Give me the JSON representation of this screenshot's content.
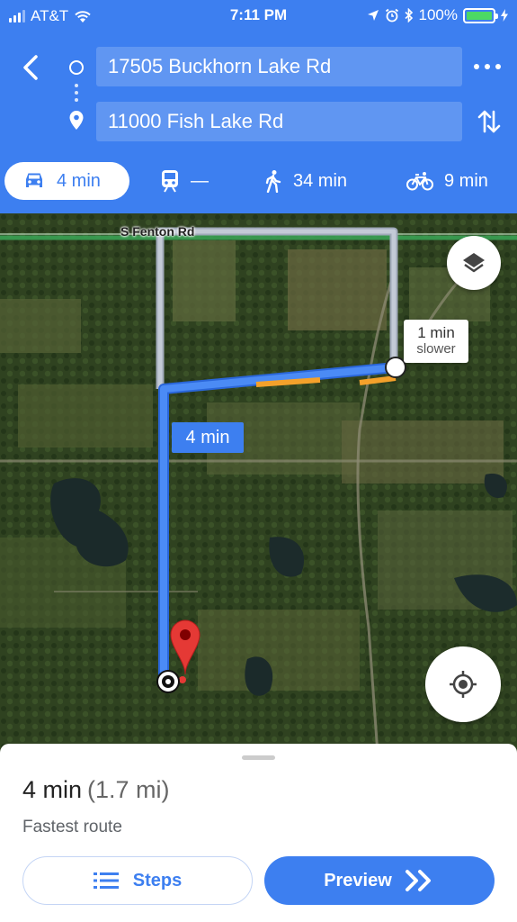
{
  "status_bar": {
    "carrier": "AT&T",
    "time": "7:11 PM",
    "battery": "100%"
  },
  "directions": {
    "origin": "17505 Buckhorn Lake Rd",
    "destination": "11000 Fish Lake Rd"
  },
  "modes": [
    {
      "name": "drive",
      "icon": "car-icon",
      "label": "4 min",
      "active": true
    },
    {
      "name": "transit",
      "icon": "train-icon",
      "label": "—",
      "active": false
    },
    {
      "name": "walk",
      "icon": "walking-icon",
      "label": "34 min",
      "active": false
    },
    {
      "name": "bike",
      "icon": "bicycle-icon",
      "label": "9 min",
      "active": false
    }
  ],
  "map": {
    "road_label": "S Fenton Rd",
    "route_time_label": "4 min",
    "alt_route_time": "1 min",
    "alt_route_note": "slower"
  },
  "summary": {
    "duration": "4 min",
    "distance": "(1.7 mi)",
    "description": "Fastest route"
  },
  "buttons": {
    "steps": "Steps",
    "preview": "Preview"
  },
  "colors": {
    "accent": "#3d7ff0",
    "traffic_slow": "#f4a12b",
    "destination_pin": "#e53935"
  }
}
